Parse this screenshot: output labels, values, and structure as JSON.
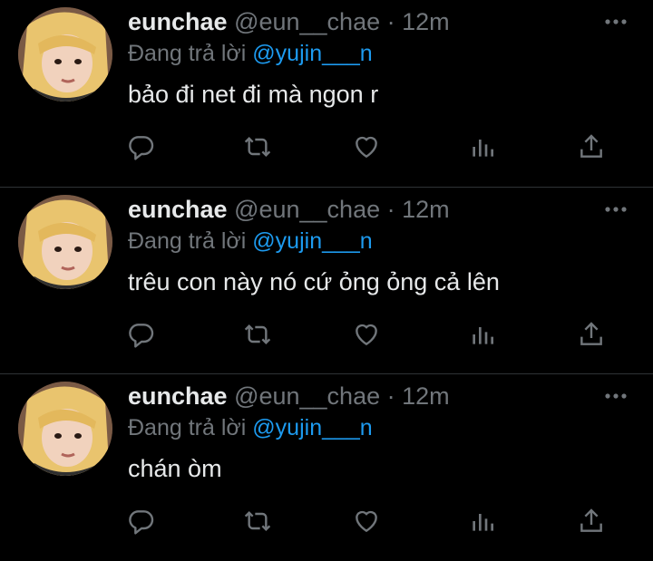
{
  "tweets": [
    {
      "name": "eunchae",
      "handle": "@eun__chae",
      "time": "· 12m",
      "reply_prefix": "Đang trả lời",
      "reply_to": "@yujin___n",
      "text": "bảo đi net đi mà ngon r"
    },
    {
      "name": "eunchae",
      "handle": "@eun__chae",
      "time": "· 12m",
      "reply_prefix": "Đang trả lời",
      "reply_to": "@yujin___n",
      "text": "trêu con này nó cứ ỏng ỏng cả lên"
    },
    {
      "name": "eunchae",
      "handle": "@eun__chae",
      "time": "· 12m",
      "reply_prefix": "Đang trả lời",
      "reply_to": "@yujin___n",
      "text": "chán òm"
    }
  ],
  "icons": {
    "reply": "reply-icon",
    "retweet": "retweet-icon",
    "like": "heart-icon",
    "views": "views-icon",
    "share": "share-icon",
    "more": "more-icon"
  },
  "colors": {
    "background": "#000000",
    "text": "#e7e9ea",
    "muted": "#71767b",
    "accent": "#1d9bf0",
    "divider": "#2f3336"
  }
}
